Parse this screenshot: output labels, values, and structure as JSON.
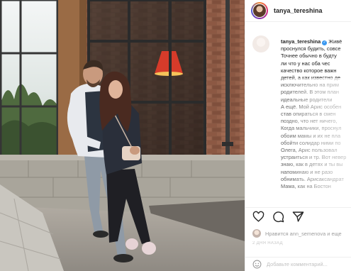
{
  "post": {
    "username": "tanya_tereshina",
    "photo_alt": "Фото"
  },
  "caption": {
    "username": "tanya_tereshina",
    "lines": [
      "Живё",
      "проснулся будить, совсе",
      "Точнее обычно в будту",
      "ли что у нас оба чес",
      "качество которое важн",
      "детей, а как известно де",
      "исключительно на прим",
      "родителей. В этом план",
      "идеальные родители",
      "А ещё. Мой Арис особен",
      "став опираться в смен",
      "поздно, что нет ничего,",
      "Когда мальчики, проснул",
      "обоим мамы и их не пла",
      "обойти солидар ними по",
      "Олега, Арис пользовал",
      "устраиться и тр. Вот невер",
      "знаю, как в детях и ты вы",
      "напоминаю и не разо",
      "обнимать. Арисаксандрат",
      "Мама, как на Бостон"
    ]
  },
  "actions": {
    "like_icon": "heart-icon",
    "comment_icon": "comment-icon",
    "share_icon": "share-icon"
  },
  "likes": {
    "text": "Нравится ann_semenova и еще"
  },
  "date": {
    "text": "2 ДНЯ НАЗАД"
  },
  "comment": {
    "placeholder": "Добавьте комментарий..."
  }
}
